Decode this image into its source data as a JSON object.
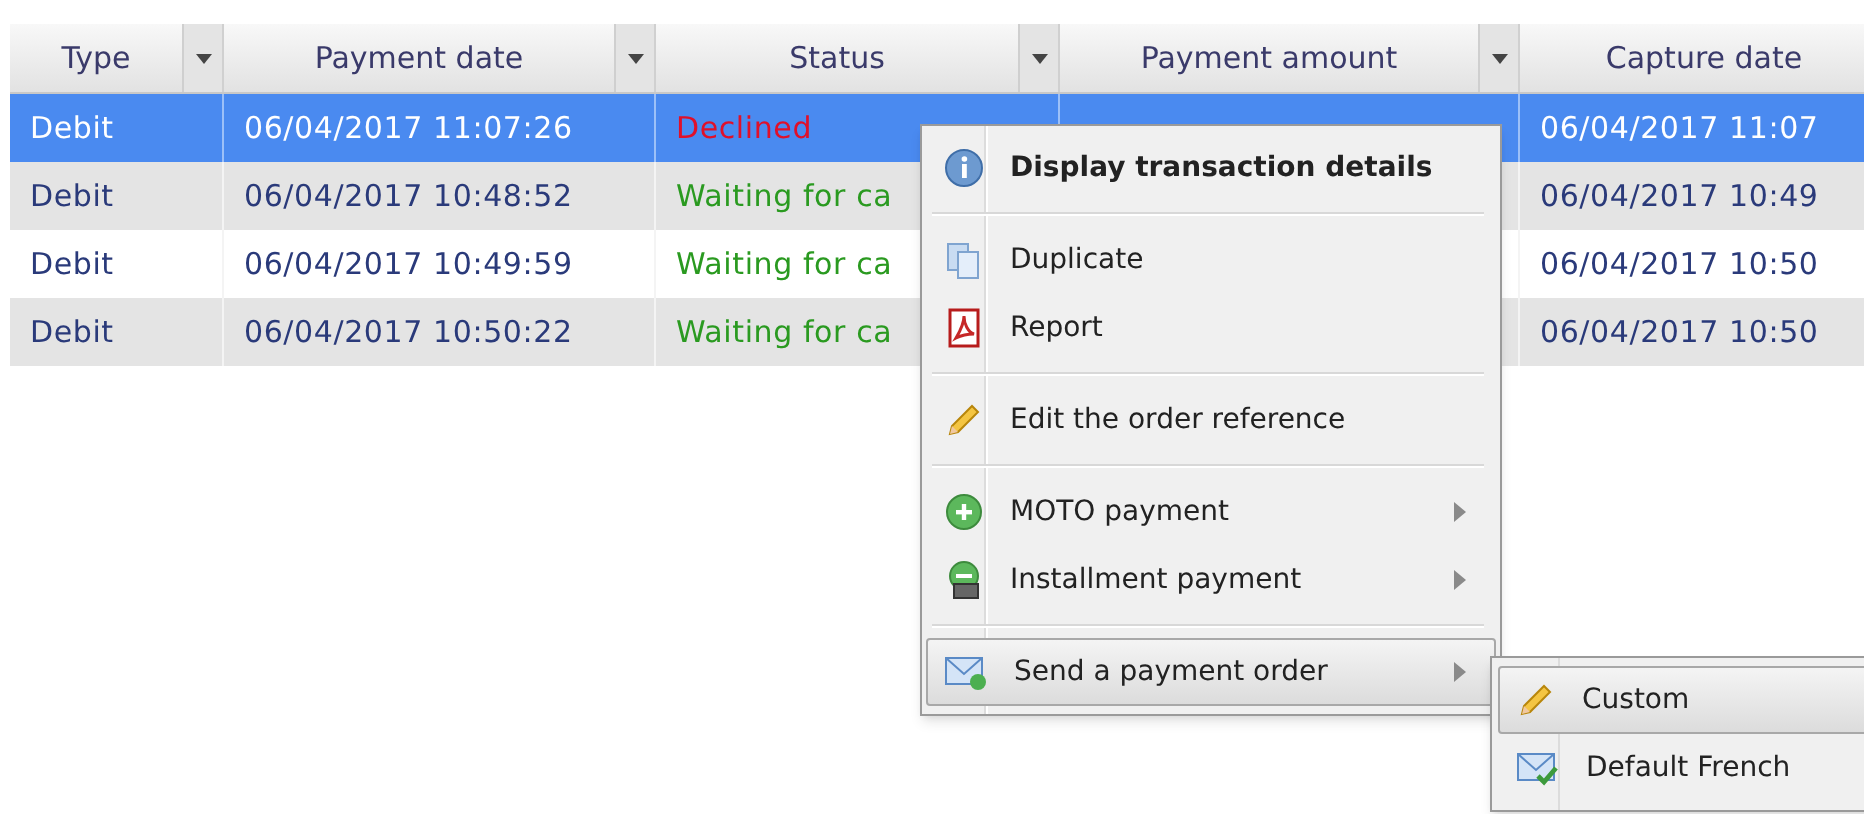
{
  "table": {
    "columns": [
      {
        "label": "Type",
        "filter": true
      },
      {
        "label": "Payment date",
        "filter": true
      },
      {
        "label": "Status",
        "filter": true
      },
      {
        "label": "Payment amount",
        "filter": true
      },
      {
        "label": "Capture date",
        "filter": false
      }
    ],
    "rows": [
      {
        "selected": true,
        "type": "Debit",
        "payment_date": "06/04/2017 11:07:26",
        "status": "Declined",
        "color": "#e0102a",
        "capture_date": "06/04/2017 11:07"
      },
      {
        "selected": false,
        "type": "Debit",
        "payment_date": "06/04/2017 10:48:52",
        "status": "Waiting for ca",
        "color": "#2a9a20",
        "capture_date": "06/04/2017 10:49"
      },
      {
        "selected": false,
        "type": "Debit",
        "payment_date": "06/04/2017 10:49:59",
        "status": "Waiting for ca",
        "color": "#2a9a20",
        "capture_date": "06/04/2017 10:50"
      },
      {
        "selected": false,
        "type": "Debit",
        "payment_date": "06/04/2017 10:50:22",
        "status": "Waiting for ca",
        "color": "#2a9a20",
        "capture_date": "06/04/2017 10:50"
      }
    ]
  },
  "context_menu": {
    "groups": [
      [
        {
          "label": "Display transaction details",
          "bold": true,
          "submenu": false,
          "selected": false
        }
      ],
      [
        {
          "label": "Duplicate",
          "bold": false,
          "submenu": false,
          "selected": false
        },
        {
          "label": "Report",
          "bold": false,
          "submenu": false,
          "selected": false
        }
      ],
      [
        {
          "label": "Edit the order reference",
          "bold": false,
          "submenu": false,
          "selected": false
        }
      ],
      [
        {
          "label": "MOTO payment",
          "bold": false,
          "submenu": true,
          "selected": false
        },
        {
          "label": "Installment payment",
          "bold": false,
          "submenu": true,
          "selected": false
        }
      ],
      [
        {
          "label": "Send a payment order",
          "bold": false,
          "submenu": true,
          "selected": true
        }
      ]
    ]
  },
  "submenu": {
    "items": [
      {
        "label": "Custom",
        "selected": true
      },
      {
        "label": "Default French",
        "selected": false
      }
    ]
  }
}
